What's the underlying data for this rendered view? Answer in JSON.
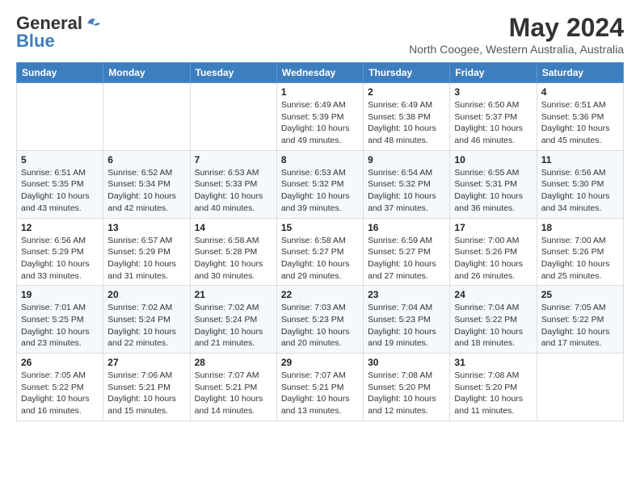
{
  "header": {
    "logo_line1": "General",
    "logo_line2": "Blue",
    "month_title": "May 2024",
    "subtitle": "North Coogee, Western Australia, Australia"
  },
  "weekdays": [
    "Sunday",
    "Monday",
    "Tuesday",
    "Wednesday",
    "Thursday",
    "Friday",
    "Saturday"
  ],
  "weeks": [
    [
      {
        "day": "",
        "detail": ""
      },
      {
        "day": "",
        "detail": ""
      },
      {
        "day": "",
        "detail": ""
      },
      {
        "day": "1",
        "detail": "Sunrise: 6:49 AM\nSunset: 5:39 PM\nDaylight: 10 hours and 49 minutes."
      },
      {
        "day": "2",
        "detail": "Sunrise: 6:49 AM\nSunset: 5:38 PM\nDaylight: 10 hours and 48 minutes."
      },
      {
        "day": "3",
        "detail": "Sunrise: 6:50 AM\nSunset: 5:37 PM\nDaylight: 10 hours and 46 minutes."
      },
      {
        "day": "4",
        "detail": "Sunrise: 6:51 AM\nSunset: 5:36 PM\nDaylight: 10 hours and 45 minutes."
      }
    ],
    [
      {
        "day": "5",
        "detail": "Sunrise: 6:51 AM\nSunset: 5:35 PM\nDaylight: 10 hours and 43 minutes."
      },
      {
        "day": "6",
        "detail": "Sunrise: 6:52 AM\nSunset: 5:34 PM\nDaylight: 10 hours and 42 minutes."
      },
      {
        "day": "7",
        "detail": "Sunrise: 6:53 AM\nSunset: 5:33 PM\nDaylight: 10 hours and 40 minutes."
      },
      {
        "day": "8",
        "detail": "Sunrise: 6:53 AM\nSunset: 5:32 PM\nDaylight: 10 hours and 39 minutes."
      },
      {
        "day": "9",
        "detail": "Sunrise: 6:54 AM\nSunset: 5:32 PM\nDaylight: 10 hours and 37 minutes."
      },
      {
        "day": "10",
        "detail": "Sunrise: 6:55 AM\nSunset: 5:31 PM\nDaylight: 10 hours and 36 minutes."
      },
      {
        "day": "11",
        "detail": "Sunrise: 6:56 AM\nSunset: 5:30 PM\nDaylight: 10 hours and 34 minutes."
      }
    ],
    [
      {
        "day": "12",
        "detail": "Sunrise: 6:56 AM\nSunset: 5:29 PM\nDaylight: 10 hours and 33 minutes."
      },
      {
        "day": "13",
        "detail": "Sunrise: 6:57 AM\nSunset: 5:29 PM\nDaylight: 10 hours and 31 minutes."
      },
      {
        "day": "14",
        "detail": "Sunrise: 6:58 AM\nSunset: 5:28 PM\nDaylight: 10 hours and 30 minutes."
      },
      {
        "day": "15",
        "detail": "Sunrise: 6:58 AM\nSunset: 5:27 PM\nDaylight: 10 hours and 29 minutes."
      },
      {
        "day": "16",
        "detail": "Sunrise: 6:59 AM\nSunset: 5:27 PM\nDaylight: 10 hours and 27 minutes."
      },
      {
        "day": "17",
        "detail": "Sunrise: 7:00 AM\nSunset: 5:26 PM\nDaylight: 10 hours and 26 minutes."
      },
      {
        "day": "18",
        "detail": "Sunrise: 7:00 AM\nSunset: 5:26 PM\nDaylight: 10 hours and 25 minutes."
      }
    ],
    [
      {
        "day": "19",
        "detail": "Sunrise: 7:01 AM\nSunset: 5:25 PM\nDaylight: 10 hours and 23 minutes."
      },
      {
        "day": "20",
        "detail": "Sunrise: 7:02 AM\nSunset: 5:24 PM\nDaylight: 10 hours and 22 minutes."
      },
      {
        "day": "21",
        "detail": "Sunrise: 7:02 AM\nSunset: 5:24 PM\nDaylight: 10 hours and 21 minutes."
      },
      {
        "day": "22",
        "detail": "Sunrise: 7:03 AM\nSunset: 5:23 PM\nDaylight: 10 hours and 20 minutes."
      },
      {
        "day": "23",
        "detail": "Sunrise: 7:04 AM\nSunset: 5:23 PM\nDaylight: 10 hours and 19 minutes."
      },
      {
        "day": "24",
        "detail": "Sunrise: 7:04 AM\nSunset: 5:22 PM\nDaylight: 10 hours and 18 minutes."
      },
      {
        "day": "25",
        "detail": "Sunrise: 7:05 AM\nSunset: 5:22 PM\nDaylight: 10 hours and 17 minutes."
      }
    ],
    [
      {
        "day": "26",
        "detail": "Sunrise: 7:05 AM\nSunset: 5:22 PM\nDaylight: 10 hours and 16 minutes."
      },
      {
        "day": "27",
        "detail": "Sunrise: 7:06 AM\nSunset: 5:21 PM\nDaylight: 10 hours and 15 minutes."
      },
      {
        "day": "28",
        "detail": "Sunrise: 7:07 AM\nSunset: 5:21 PM\nDaylight: 10 hours and 14 minutes."
      },
      {
        "day": "29",
        "detail": "Sunrise: 7:07 AM\nSunset: 5:21 PM\nDaylight: 10 hours and 13 minutes."
      },
      {
        "day": "30",
        "detail": "Sunrise: 7:08 AM\nSunset: 5:20 PM\nDaylight: 10 hours and 12 minutes."
      },
      {
        "day": "31",
        "detail": "Sunrise: 7:08 AM\nSunset: 5:20 PM\nDaylight: 10 hours and 11 minutes."
      },
      {
        "day": "",
        "detail": ""
      }
    ]
  ]
}
